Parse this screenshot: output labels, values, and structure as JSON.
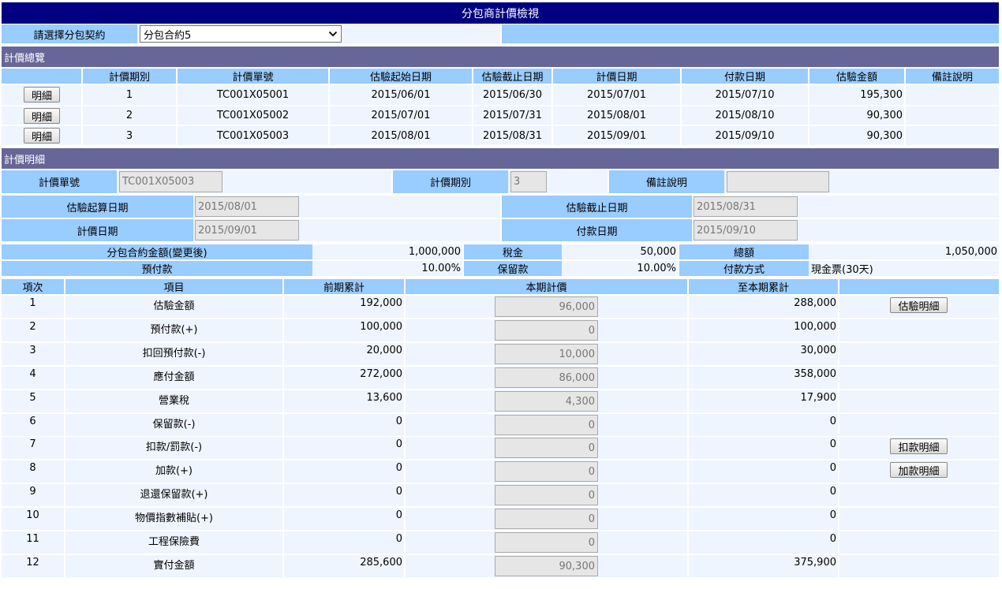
{
  "title": "分包商計價檢視",
  "contract": {
    "label": "請選擇分包契約",
    "selected": "分包合約5"
  },
  "summary": {
    "section_title": "計價總覽",
    "headers": [
      "計價期別",
      "計價單號",
      "估驗起始日期",
      "估驗截止日期",
      "計價日期",
      "付款日期",
      "估驗金額",
      "備註說明"
    ],
    "detail_button": "明細",
    "rows": [
      {
        "period": "1",
        "no": "TC001X05001",
        "start": "2015/06/01",
        "end": "2015/06/30",
        "pricing_date": "2015/07/01",
        "pay_date": "2015/07/10",
        "amount": "195,300",
        "note": ""
      },
      {
        "period": "2",
        "no": "TC001X05002",
        "start": "2015/07/01",
        "end": "2015/07/31",
        "pricing_date": "2015/08/01",
        "pay_date": "2015/08/10",
        "amount": "90,300",
        "note": ""
      },
      {
        "period": "3",
        "no": "TC001X05003",
        "start": "2015/08/01",
        "end": "2015/08/31",
        "pricing_date": "2015/09/01",
        "pay_date": "2015/09/10",
        "amount": "90,300",
        "note": ""
      }
    ]
  },
  "detail": {
    "section_title": "計價明細",
    "no_label": "計價單號",
    "no_value": "TC001X05003",
    "period_label": "計價期別",
    "period_value": "3",
    "note_label": "備註說明",
    "note_value": "",
    "start_label": "估驗起算日期",
    "start_value": "2015/08/01",
    "end_label": "估驗截止日期",
    "end_value": "2015/08/31",
    "pricing_label": "計價日期",
    "pricing_value": "2015/09/01",
    "pay_label": "付款日期",
    "pay_value": "2015/09/10",
    "contract_amount_label": "分包合約金額(變更後)",
    "contract_amount_value": "1,000,000",
    "tax_label": "稅金",
    "tax_value": "50,000",
    "total_label": "總額",
    "total_value": "1,050,000",
    "prepay_label": "預付款",
    "prepay_value": "10.00%",
    "retention_label": "保留款",
    "retention_value": "10.00%",
    "pay_method_label": "付款方式",
    "pay_method_value": "現金票(30天)"
  },
  "items": {
    "headers": [
      "項次",
      "項目",
      "前期累計",
      "本期計價",
      "至本期累計"
    ],
    "rows": [
      {
        "no": "1",
        "name": "估驗金額",
        "prev": "192,000",
        "curr": "96,000",
        "cum": "288,000",
        "button": "估驗明細"
      },
      {
        "no": "2",
        "name": "預付款(+)",
        "prev": "100,000",
        "curr": "0",
        "cum": "100,000",
        "button": ""
      },
      {
        "no": "3",
        "name": "扣回預付款(-)",
        "prev": "20,000",
        "curr": "10,000",
        "cum": "30,000",
        "button": ""
      },
      {
        "no": "4",
        "name": "應付金額",
        "prev": "272,000",
        "curr": "86,000",
        "cum": "358,000",
        "button": ""
      },
      {
        "no": "5",
        "name": "營業稅",
        "prev": "13,600",
        "curr": "4,300",
        "cum": "17,900",
        "button": ""
      },
      {
        "no": "6",
        "name": "保留款(-)",
        "prev": "0",
        "curr": "0",
        "cum": "0",
        "button": ""
      },
      {
        "no": "7",
        "name": "扣款/罰款(-)",
        "prev": "0",
        "curr": "0",
        "cum": "0",
        "button": "扣款明細"
      },
      {
        "no": "8",
        "name": "加款(+)",
        "prev": "0",
        "curr": "0",
        "cum": "0",
        "button": "加款明細"
      },
      {
        "no": "9",
        "name": "退還保留款(+)",
        "prev": "0",
        "curr": "0",
        "cum": "0",
        "button": ""
      },
      {
        "no": "10",
        "name": "物價指數補貼(+)",
        "prev": "0",
        "curr": "0",
        "cum": "0",
        "button": ""
      },
      {
        "no": "11",
        "name": "工程保險費",
        "prev": "0",
        "curr": "0",
        "cum": "0",
        "button": ""
      },
      {
        "no": "12",
        "name": "實付金額",
        "prev": "285,600",
        "curr": "90,300",
        "cum": "375,900",
        "button": ""
      }
    ]
  }
}
